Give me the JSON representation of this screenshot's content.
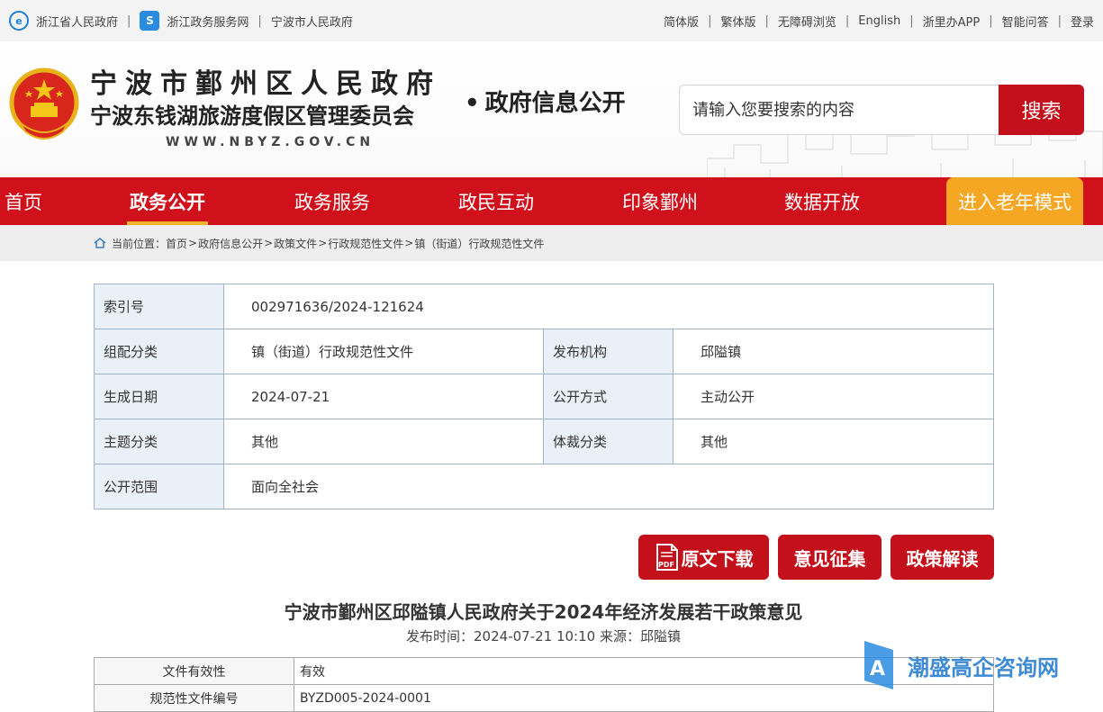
{
  "topbar": {
    "left_links": [
      "浙江省人民政府",
      "浙江政务服务网",
      "宁波市人民政府"
    ],
    "right_links": [
      "简体版",
      "繁体版",
      "无障碍浏览",
      "English",
      "浙里办APP",
      "智能问答",
      "登录"
    ]
  },
  "header": {
    "title1": "宁波市鄞州区人民政府",
    "title2": "宁波东钱湖旅游度假区管理委员会",
    "domain": "WWW.NBYZ.GOV.CN",
    "subtitle": "政府信息公开",
    "search_placeholder": "请输入您要搜索的内容",
    "search_button": "搜索"
  },
  "nav": {
    "items": [
      "首页",
      "政务公开",
      "政务服务",
      "政民互动",
      "印象鄞州",
      "数据开放"
    ],
    "active": "政务公开",
    "elder_mode": "进入老年模式"
  },
  "breadcrumb": {
    "label": "当前位置：",
    "items": [
      "首页",
      "政府信息公开",
      "政策文件",
      "行政规范性文件",
      "镇（街道）行政规范性文件"
    ]
  },
  "info": {
    "index_label": "索引号",
    "index_value": "002971636/2024-121624",
    "category_label": "组配分类",
    "category_value": "镇（街道）行政规范性文件",
    "issuer_label": "发布机构",
    "issuer_value": "邱隘镇",
    "date_label": "生成日期",
    "date_value": "2024-07-21",
    "public_label": "公开方式",
    "public_value": "主动公开",
    "topic_label": "主题分类",
    "topic_value": "其他",
    "genre_label": "体裁分类",
    "genre_value": "其他",
    "scope_label": "公开范围",
    "scope_value": "面向全社会"
  },
  "actions": {
    "download": "原文下载",
    "feedback": "意见征集",
    "interpret": "政策解读"
  },
  "document": {
    "title": "宁波市鄞州区邱隘镇人民政府关于2024年经济发展若干政策意见",
    "meta": "发布时间：2024-07-21 10:10 来源：邱隘镇"
  },
  "validity": {
    "row1_label": "文件有效性",
    "row1_value": "有效",
    "row2_label": "规范性文件编号",
    "row2_value": "BYZD005-2024-0001"
  },
  "watermark": "潮盛高企咨询网",
  "colors": {
    "primary_red": "#d0111b",
    "elder_orange": "#f5a623",
    "table_key_bg": "#eaf0f7"
  }
}
